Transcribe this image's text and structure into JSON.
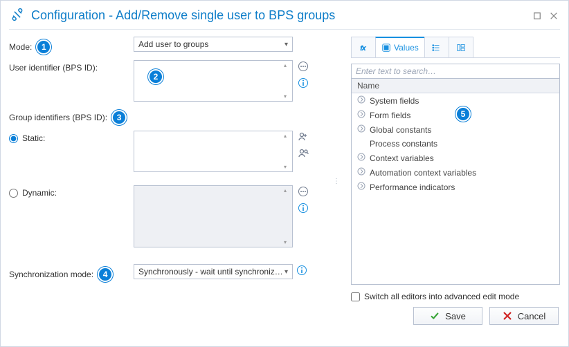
{
  "title": "Configuration - Add/Remove single user to BPS groups",
  "left": {
    "mode_label": "Mode:",
    "mode_value": "Add user to groups",
    "user_id_label": "User identifier (BPS ID):",
    "group_id_label": "Group identifiers (BPS ID):",
    "static_label": "Static:",
    "dynamic_label": "Dynamic:",
    "sync_label": "Synchronization mode:",
    "sync_value": "Synchronously - wait until synchronization f…"
  },
  "bubbles": {
    "mode": "1",
    "user": "2",
    "group": "3",
    "sync": "4",
    "tree": "5"
  },
  "right": {
    "tab_values": "Values",
    "search_placeholder": "Enter text to search…",
    "tree_header": "Name",
    "items": [
      "System fields",
      "Form fields",
      "Global constants",
      "Process constants",
      "Context variables",
      "Automation context variables",
      "Performance indicators"
    ],
    "advanced_label": "Switch all editors into advanced edit mode"
  },
  "buttons": {
    "save": "Save",
    "cancel": "Cancel"
  },
  "chart_data": null
}
